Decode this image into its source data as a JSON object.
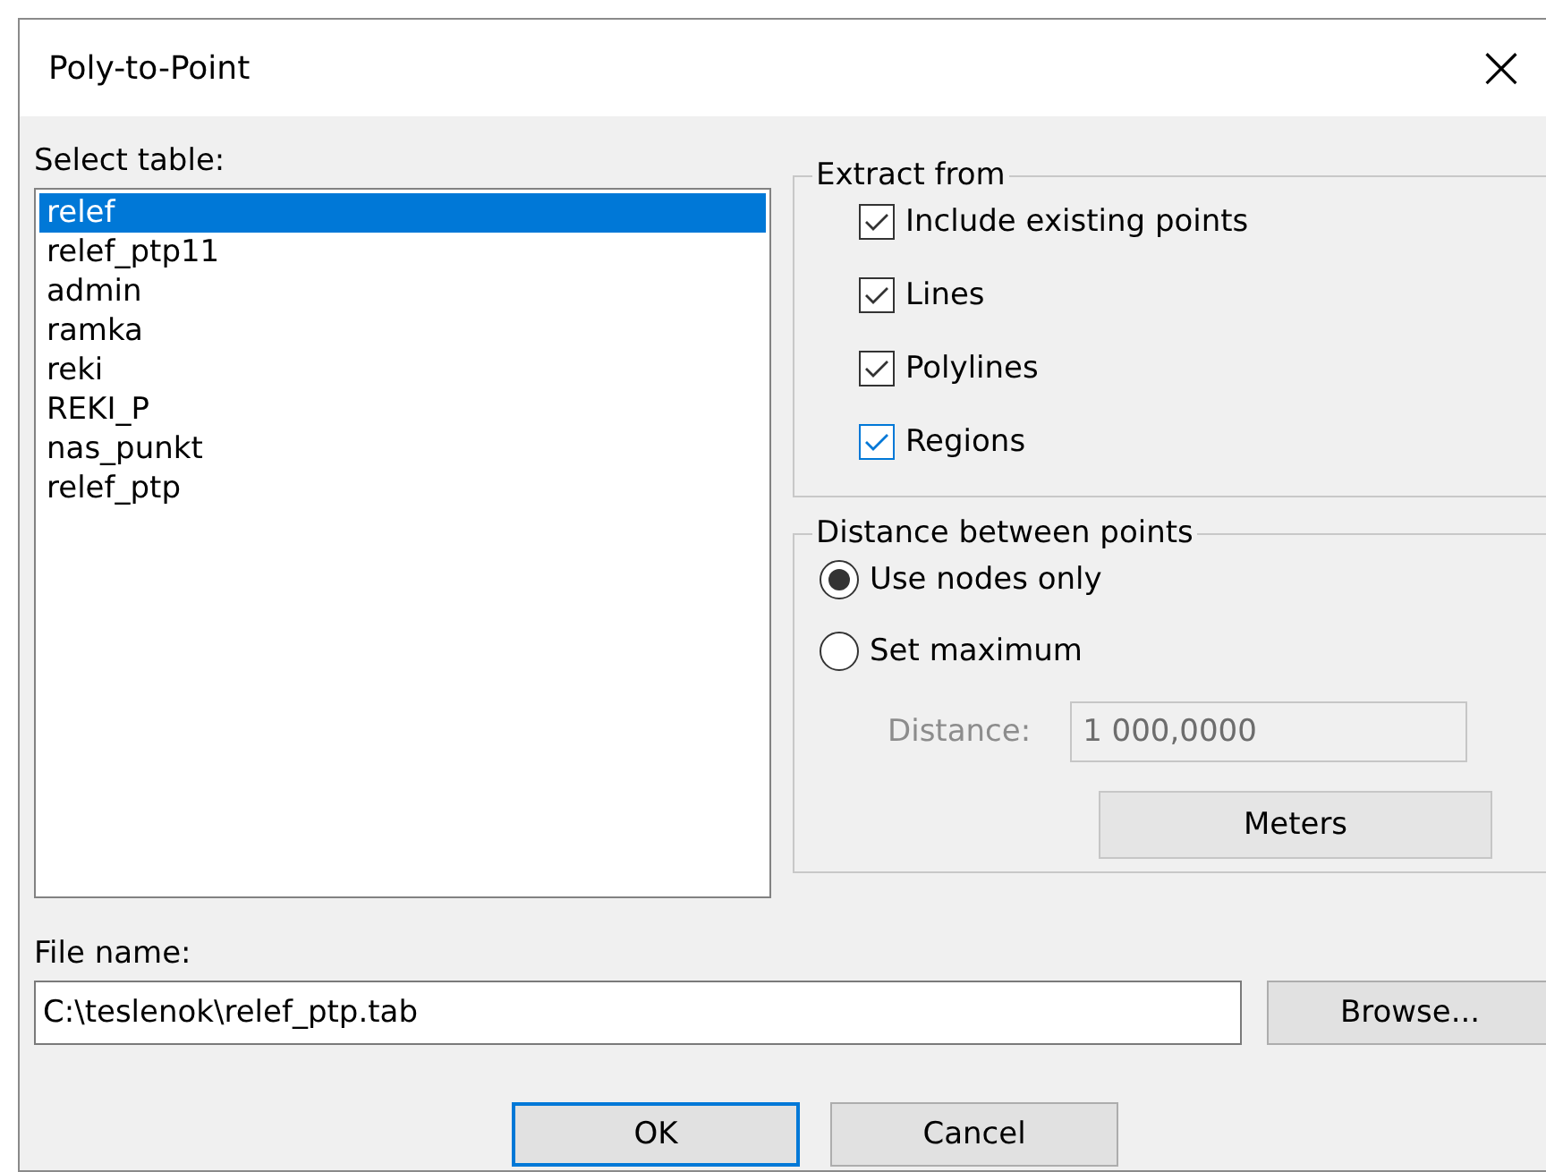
{
  "window": {
    "title": "Poly-to-Point",
    "close": "×"
  },
  "table_select": {
    "label": "Select table:",
    "items": [
      {
        "name": "relef",
        "selected": true
      },
      {
        "name": "relef_ptp11",
        "selected": false
      },
      {
        "name": "admin",
        "selected": false
      },
      {
        "name": "ramka",
        "selected": false
      },
      {
        "name": "reki",
        "selected": false
      },
      {
        "name": "REKI_P",
        "selected": false
      },
      {
        "name": "nas_punkt",
        "selected": false
      },
      {
        "name": "relef_ptp",
        "selected": false
      }
    ]
  },
  "extract_from": {
    "title": "Extract from",
    "options": [
      {
        "label": "Include existing points",
        "checked": true,
        "highlighted": false
      },
      {
        "label": "Lines",
        "checked": true,
        "highlighted": false
      },
      {
        "label": "Polylines",
        "checked": true,
        "highlighted": false
      },
      {
        "label": "Regions",
        "checked": true,
        "highlighted": true
      }
    ]
  },
  "distance": {
    "title": "Distance between points",
    "options": [
      {
        "label": "Use nodes only",
        "selected": true
      },
      {
        "label": "Set maximum",
        "selected": false
      }
    ],
    "field": {
      "label": "Distance:",
      "value": "1 000,0000",
      "disabled": true
    },
    "units_button": "Meters"
  },
  "file_name": {
    "label": "File name:",
    "value": "C:\\teslenok\\relef_ptp.tab",
    "browse_button": "Browse..."
  },
  "buttons": [
    {
      "label": "OK",
      "default": true
    },
    {
      "label": "Cancel",
      "default": false
    }
  ]
}
